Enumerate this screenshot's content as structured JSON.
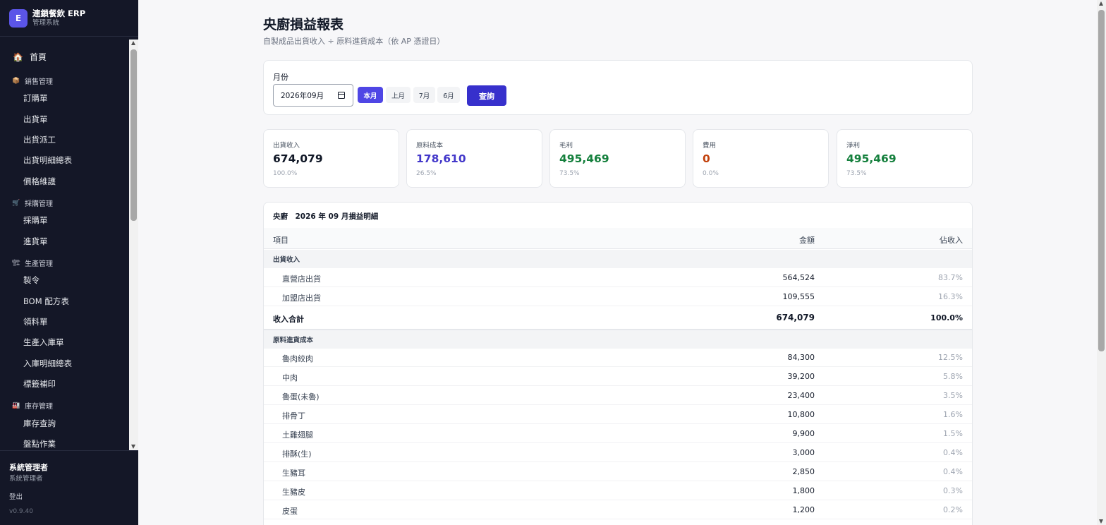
{
  "brand": {
    "logo": "E",
    "name": "連鎖餐飲 ERP",
    "subtitle": "管理系統"
  },
  "nav": {
    "home": {
      "icon": "🏠",
      "label": "首頁"
    },
    "groups": [
      {
        "icon": "📦",
        "label": "銷售管理",
        "items": [
          "訂購單",
          "出貨單",
          "出貨派工",
          "出貨明細總表",
          "價格維護"
        ]
      },
      {
        "icon": "🛒",
        "label": "採購管理",
        "items": [
          "採購單",
          "進貨單"
        ]
      },
      {
        "icon": "🏗",
        "label": "生產管理",
        "items": [
          "製令",
          "BOM 配方表",
          "領料單",
          "生產入庫單",
          "入庫明細總表",
          "標籤補印"
        ]
      },
      {
        "icon": "🏭",
        "label": "庫存管理",
        "items": [
          "庫存查詢",
          "盤點作業"
        ]
      }
    ]
  },
  "footer": {
    "user_name": "系統管理者",
    "user_role": "系統管理者",
    "logout": "登出",
    "version": "v0.9.40"
  },
  "page": {
    "title": "央廚損益報表",
    "subtitle": "自製成品出貨收入 ÷ 原料進貨成本（依 AP 憑證日）"
  },
  "filter": {
    "label": "月份",
    "month_value": "2026年09月",
    "quick_buttons": [
      {
        "label": "本月",
        "active": true
      },
      {
        "label": "上月",
        "active": false
      },
      {
        "label": "7月",
        "active": false
      },
      {
        "label": "6月",
        "active": false
      }
    ],
    "query_label": "查詢"
  },
  "kpis": [
    {
      "label": "出貨收入",
      "value": "674,079",
      "pct": "100.0%",
      "color": "#111827"
    },
    {
      "label": "原料成本",
      "value": "178,610",
      "pct": "26.5%",
      "color": "#4338ca"
    },
    {
      "label": "毛利",
      "value": "495,469",
      "pct": "73.5%",
      "color": "#15803d"
    },
    {
      "label": "費用",
      "value": "0",
      "pct": "0.0%",
      "color": "#c2410c"
    },
    {
      "label": "淨利",
      "value": "495,469",
      "pct": "73.5%",
      "color": "#15803d"
    }
  ],
  "table": {
    "title": "央廚　2026 年 09 月損益明細",
    "headers": {
      "item": "項目",
      "amount": "金額",
      "ratio": "佔收入"
    },
    "revenue_section": "出貨收入",
    "revenue_rows": [
      {
        "name": "直營店出貨",
        "amount": "564,524",
        "pct": "83.7%"
      },
      {
        "name": "加盟店出貨",
        "amount": "109,555",
        "pct": "16.3%"
      }
    ],
    "revenue_total": {
      "name": "收入合計",
      "amount": "674,079",
      "pct": "100.0%"
    },
    "cost_section": "原料進貨成本",
    "cost_rows": [
      {
        "name": "魯肉絞肉",
        "amount": "84,300",
        "pct": "12.5%"
      },
      {
        "name": "中肉",
        "amount": "39,200",
        "pct": "5.8%"
      },
      {
        "name": "魯蛋(未魯)",
        "amount": "23,400",
        "pct": "3.5%"
      },
      {
        "name": "排骨丁",
        "amount": "10,800",
        "pct": "1.6%"
      },
      {
        "name": "土雞翅腿",
        "amount": "9,900",
        "pct": "1.5%"
      },
      {
        "name": "排酥(生)",
        "amount": "3,000",
        "pct": "0.4%"
      },
      {
        "name": "生豬耳",
        "amount": "2,850",
        "pct": "0.4%"
      },
      {
        "name": "生豬皮",
        "amount": "1,800",
        "pct": "0.3%"
      },
      {
        "name": "皮蛋",
        "amount": "1,200",
        "pct": "0.2%"
      }
    ]
  }
}
